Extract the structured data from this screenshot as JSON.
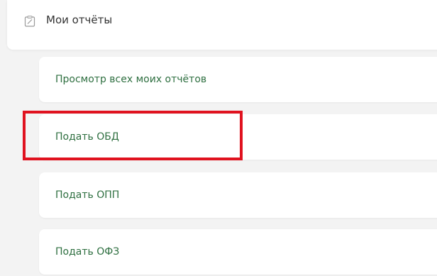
{
  "menu": {
    "header_label": "Мои отчёты",
    "header_icon": "report-icon",
    "items": [
      {
        "label": "Просмотр всех моих отчётов"
      },
      {
        "label": "Подать ОБД"
      },
      {
        "label": "Подать ОПП"
      },
      {
        "label": "Подать ОФЗ"
      }
    ]
  },
  "colors": {
    "link": "#2e6f40",
    "highlight": "#e0121f",
    "background": "#f3f3f3"
  }
}
